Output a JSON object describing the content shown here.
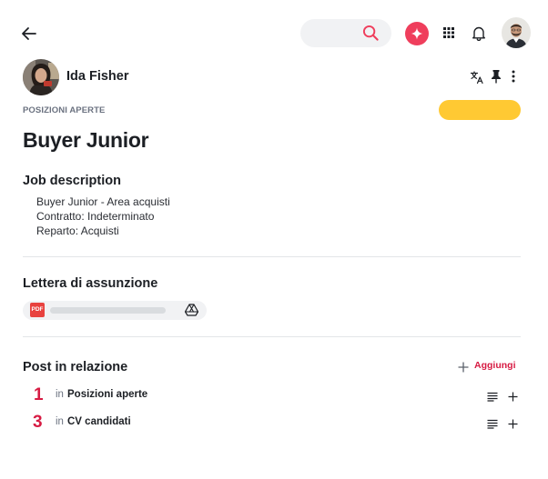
{
  "author": {
    "name": "Ida Fisher"
  },
  "post": {
    "category": "POSIZIONI APERTE",
    "title": "Buyer Junior",
    "status_color": "#ffc933"
  },
  "job_description": {
    "heading": "Job description",
    "lines": [
      "Buyer Junior - Area acquisti",
      "Contratto: Indeterminato",
      "Reparto: Acquisti"
    ]
  },
  "attachment_section": {
    "heading": "Lettera di assunzione",
    "file_type": "PDF"
  },
  "related": {
    "heading": "Post in relazione",
    "add_label": "Aggiungi",
    "items": [
      {
        "count": "1",
        "prefix": "in",
        "name": "Posizioni aperte"
      },
      {
        "count": "3",
        "prefix": "in",
        "name": "CV candidati"
      }
    ]
  },
  "colors": {
    "accent": "#d71b43",
    "ai": "#ef3e5c",
    "status": "#ffc933",
    "pdf": "#e8423f"
  },
  "icons": [
    "back-arrow-icon",
    "search-icon",
    "sparkle-icon",
    "apps-grid-icon",
    "bell-icon",
    "translate-icon",
    "pin-icon",
    "more-vertical-icon",
    "google-drive-icon",
    "plus-icon",
    "list-icon"
  ]
}
